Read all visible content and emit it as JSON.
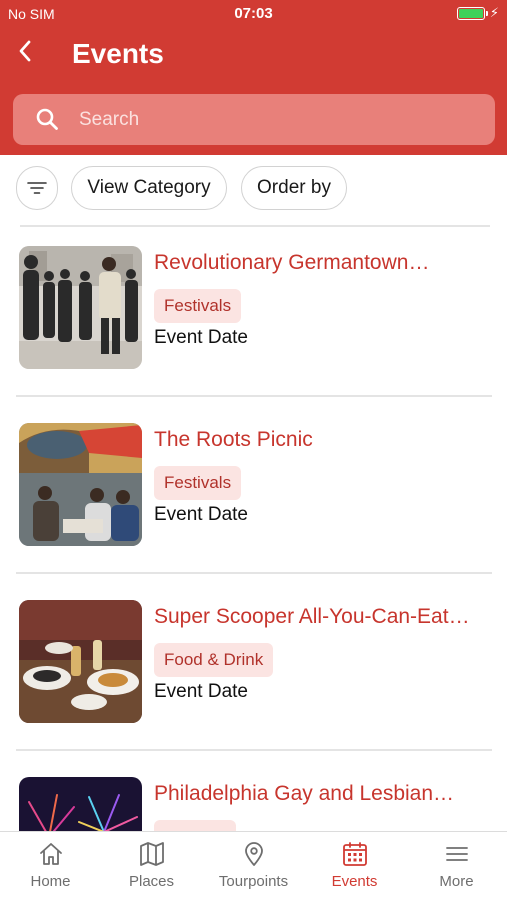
{
  "status_bar": {
    "carrier": "No SIM",
    "time": "07:03"
  },
  "header": {
    "title": "Events"
  },
  "search": {
    "placeholder": "Search"
  },
  "filters": {
    "view_category": "View Category",
    "order_by": "Order by"
  },
  "events": [
    {
      "title": "Revolutionary Germantown…",
      "tag": "Festivals",
      "date": "Event Date"
    },
    {
      "title": "The Roots Picnic",
      "tag": "Festivals",
      "date": "Event Date"
    },
    {
      "title": "Super Scooper All-You-Can-Eat…",
      "tag": "Food & Drink",
      "date": "Event Date"
    },
    {
      "title": "Philadelphia Gay and Lesbian…",
      "tag": "",
      "date": ""
    }
  ],
  "tabs": [
    {
      "label": "Home",
      "icon": "home-icon"
    },
    {
      "label": "Places",
      "icon": "map-icon"
    },
    {
      "label": "Tourpoints",
      "icon": "location-pin-icon"
    },
    {
      "label": "Events",
      "icon": "calendar-icon",
      "active": true
    },
    {
      "label": "More",
      "icon": "menu-icon"
    }
  ],
  "colors": {
    "brand": "#d13b33",
    "search_bg": "#e8807a",
    "tag_bg": "#fbe4e2",
    "battery": "#3fd15a",
    "inactive_tab": "#6e6e6e"
  }
}
